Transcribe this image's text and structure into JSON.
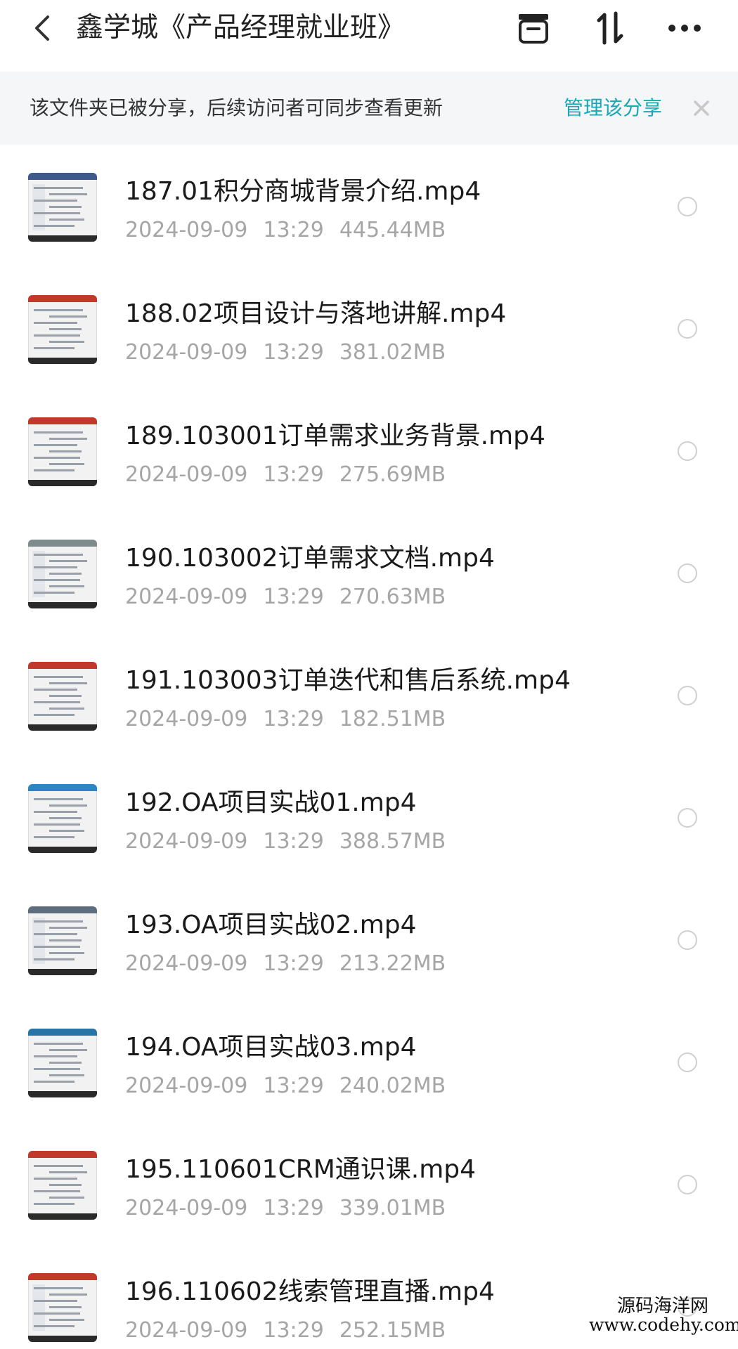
{
  "header": {
    "title": "鑫学城《产品经理就业班》",
    "icons": {
      "back": "chevron-left-icon",
      "archive": "archive-box-icon",
      "sort": "sort-arrows-icon",
      "more": "more-dots-icon"
    }
  },
  "banner": {
    "message": "该文件夹已被分享，后续访问者可同步查看更新",
    "link_label": "管理该分享",
    "link_color": "#1aa7b8",
    "close_icon": "close-icon"
  },
  "files": [
    {
      "name": "187.01积分商城背景介绍.mp4",
      "date": "2024-09-09",
      "time": "13:29",
      "size": "445.44MB",
      "thumb_accent": "#3d5a8a"
    },
    {
      "name": "188.02项目设计与落地讲解.mp4",
      "date": "2024-09-09",
      "time": "13:29",
      "size": "381.02MB",
      "thumb_accent": "#c0392b"
    },
    {
      "name": "189.103001订单需求业务背景.mp4",
      "date": "2024-09-09",
      "time": "13:29",
      "size": "275.69MB",
      "thumb_accent": "#c0392b"
    },
    {
      "name": "190.103002订单需求文档.mp4",
      "date": "2024-09-09",
      "time": "13:29",
      "size": "270.63MB",
      "thumb_accent": "#7f8c8d"
    },
    {
      "name": "191.103003订单迭代和售后系统.mp4",
      "date": "2024-09-09",
      "time": "13:29",
      "size": "182.51MB",
      "thumb_accent": "#c0392b"
    },
    {
      "name": "192.OA项目实战01.mp4",
      "date": "2024-09-09",
      "time": "13:29",
      "size": "388.57MB",
      "thumb_accent": "#2e86c1"
    },
    {
      "name": "193.OA项目实战02.mp4",
      "date": "2024-09-09",
      "time": "13:29",
      "size": "213.22MB",
      "thumb_accent": "#5d6d7e"
    },
    {
      "name": "194.OA项目实战03.mp4",
      "date": "2024-09-09",
      "time": "13:29",
      "size": "240.02MB",
      "thumb_accent": "#2874a6"
    },
    {
      "name": "195.110601CRM通识课.mp4",
      "date": "2024-09-09",
      "time": "13:29",
      "size": "339.01MB",
      "thumb_accent": "#c0392b"
    },
    {
      "name": "196.110602线索管理直播.mp4",
      "date": "2024-09-09",
      "time": "13:29",
      "size": "252.15MB",
      "thumb_accent": "#c0392b"
    }
  ],
  "watermark": {
    "line1": "源码海洋网",
    "line2": "www.codehy.com"
  }
}
